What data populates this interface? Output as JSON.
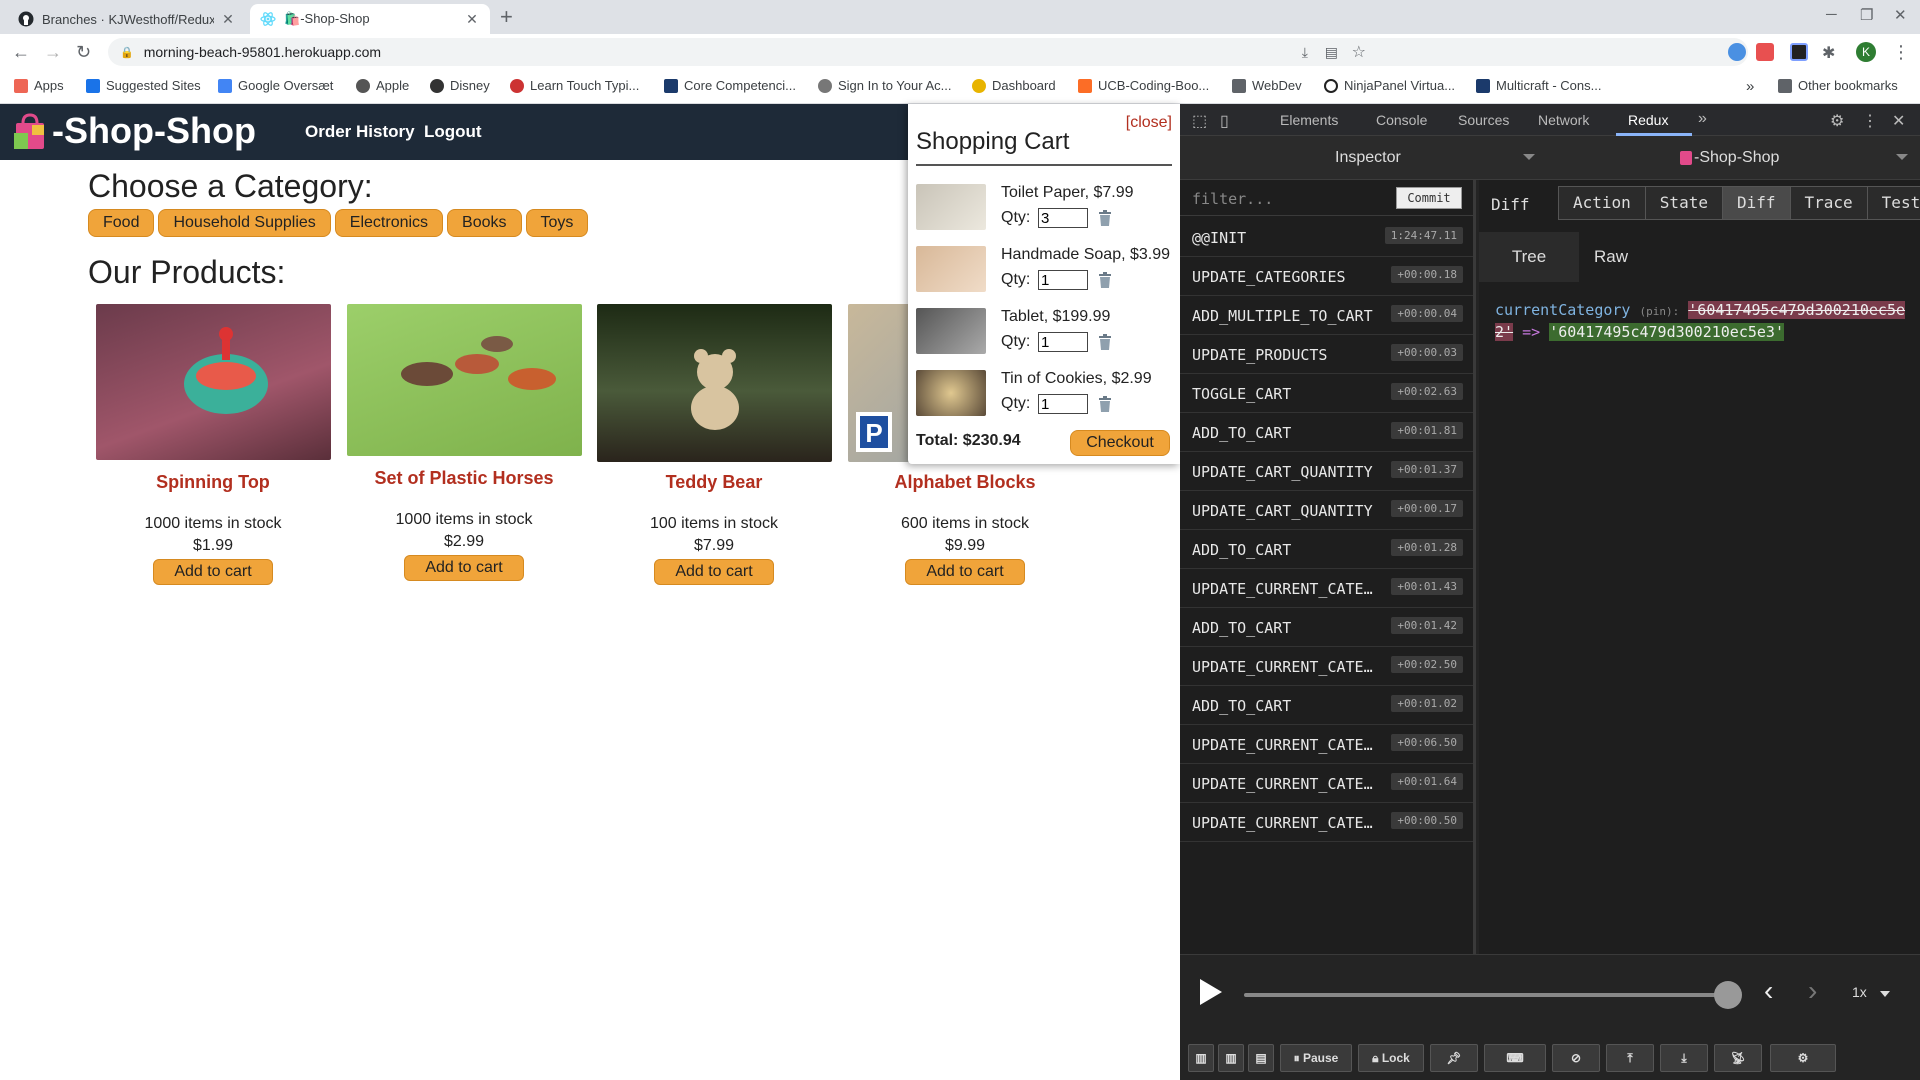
{
  "browser": {
    "tabs": [
      {
        "title": "Branches · KJWesthoff/Redux",
        "active": false
      },
      {
        "title": "-Shop-Shop",
        "active": true
      }
    ],
    "url": "morning-beach-95801.herokuapp.com",
    "bookmarks": [
      "Apps",
      "Suggested Sites",
      "Google Oversæt",
      "Apple",
      "Disney",
      "Learn Touch Typi...",
      "Core Competenci...",
      "Sign In to Your Ac...",
      "Dashboard",
      "UCB-Coding-Boo...",
      "WebDev",
      "NinjaPanel Virtua...",
      "Multicraft - Cons..."
    ],
    "other_bookmarks": "Other bookmarks",
    "more_bookmarks": "»",
    "profile_initial": "K"
  },
  "site": {
    "brand": "-Shop-Shop",
    "nav": {
      "order_history": "Order History",
      "logout": "Logout"
    },
    "choose_title": "Choose a Category:",
    "categories": [
      "Food",
      "Household Supplies",
      "Electronics",
      "Books",
      "Toys"
    ],
    "products_title": "Our Products:",
    "products": [
      {
        "name": "Spinning Top",
        "stock": "1000 items in stock",
        "price": "$1.99",
        "button": "Add to cart",
        "color": "#8c4a5a"
      },
      {
        "name": "Set of Plastic Horses",
        "stock": "1000 items in stock",
        "price": "$2.99",
        "button": "Add to cart",
        "color": "#8fbf5a"
      },
      {
        "name": "Teddy Bear",
        "stock": "100 items in stock",
        "price": "$7.99",
        "button": "Add to cart",
        "color": "#2f3a22"
      },
      {
        "name": "Alphabet Blocks",
        "stock": "600 items in stock",
        "price": "$9.99",
        "button": "Add to cart",
        "color": "#b8a88a"
      }
    ]
  },
  "cart": {
    "close": "[close]",
    "title": "Shopping Cart",
    "qty_label": "Qty:",
    "items": [
      {
        "label": "Toilet Paper, $7.99",
        "qty": "3",
        "color": "#d9d5cc"
      },
      {
        "label": "Handmade Soap, $3.99",
        "qty": "1",
        "color": "#e8c9ae"
      },
      {
        "label": "Tablet, $199.99",
        "qty": "1",
        "color": "#6b6b6b"
      },
      {
        "label": "Tin of Cookies, $2.99",
        "qty": "1",
        "color": "#8a7355"
      }
    ],
    "total": "Total: $230.94",
    "checkout": "Checkout"
  },
  "devtools": {
    "tabs": [
      "Elements",
      "Console",
      "Sources",
      "Network",
      "Redux"
    ],
    "active_tab": "Redux",
    "more": "»",
    "redux": {
      "inspector": "Inspector",
      "store": "-Shop-Shop",
      "filter_placeholder": "filter...",
      "commit": "Commit",
      "actions": [
        {
          "name": "@@INIT",
          "time": "1:24:47.11"
        },
        {
          "name": "UPDATE_CATEGORIES",
          "time": "+00:00.18"
        },
        {
          "name": "ADD_MULTIPLE_TO_CART",
          "time": "+00:00.04"
        },
        {
          "name": "UPDATE_PRODUCTS",
          "time": "+00:00.03"
        },
        {
          "name": "TOGGLE_CART",
          "time": "+00:02.63"
        },
        {
          "name": "ADD_TO_CART",
          "time": "+00:01.81"
        },
        {
          "name": "UPDATE_CART_QUANTITY",
          "time": "+00:01.37"
        },
        {
          "name": "UPDATE_CART_QUANTITY",
          "time": "+00:00.17"
        },
        {
          "name": "ADD_TO_CART",
          "time": "+00:01.28"
        },
        {
          "name": "UPDATE_CURRENT_CATEG...",
          "time": "+00:01.43"
        },
        {
          "name": "ADD_TO_CART",
          "time": "+00:01.42"
        },
        {
          "name": "UPDATE_CURRENT_CATEG...",
          "time": "+00:02.50"
        },
        {
          "name": "ADD_TO_CART",
          "time": "+00:01.02"
        },
        {
          "name": "UPDATE_CURRENT_CATEG...",
          "time": "+00:06.50"
        },
        {
          "name": "UPDATE_CURRENT_CATEG...",
          "time": "+00:01.64"
        },
        {
          "name": "UPDATE_CURRENT_CATEG...",
          "time": "+00:00.50"
        }
      ],
      "diff_label": "Diff",
      "right_tabs": [
        "Action",
        "State",
        "Diff",
        "Trace",
        "Test"
      ],
      "active_right_tab": "Diff",
      "sub_tabs": [
        "Tree",
        "Raw"
      ],
      "diff": {
        "key": "currentCategory",
        "pin": "(pin):",
        "old_value": "'60417495c479d300210ec5e2'",
        "arrow": "=>",
        "new_value": "'60417495c479d300210ec5e3'"
      },
      "speed": "1x",
      "slider_position": 1.0,
      "bottom_buttons": {
        "pause": "Pause",
        "lock": "Lock"
      }
    }
  },
  "colors": {
    "accent": "#f0a43a",
    "product_title": "#b22f1f",
    "header_bg": "#1e2a38"
  }
}
